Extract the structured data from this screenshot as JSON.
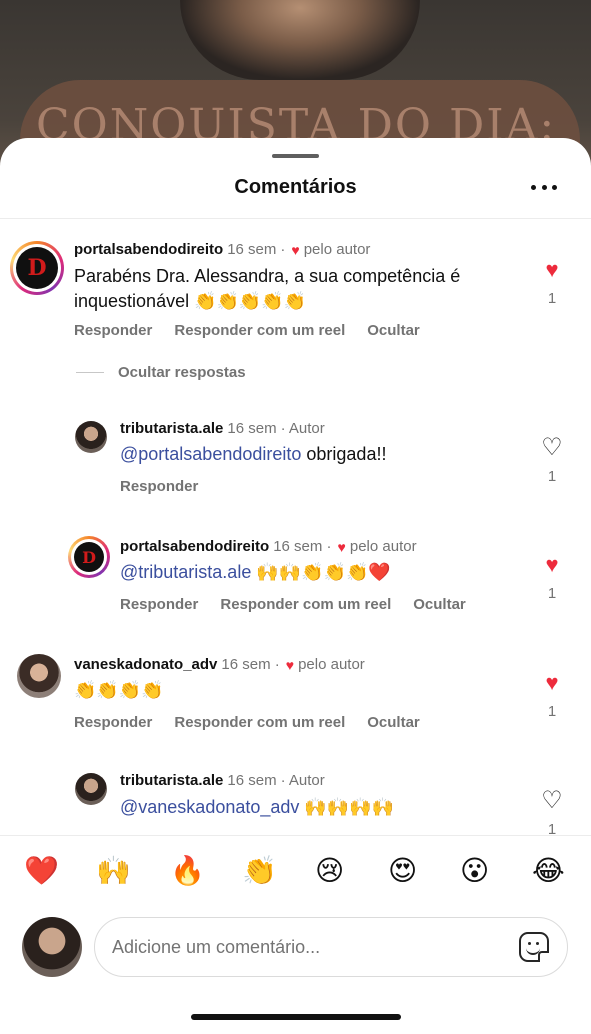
{
  "background": {
    "banner_text": "CONQUISTA DO DIA:"
  },
  "header": {
    "title": "Comentários"
  },
  "comments": [
    {
      "username": "portalsabendodireito",
      "avatar_letter": "D",
      "time": "16 sem",
      "liked_by_author": "pelo autor",
      "text_line1": "Parabéns Dra. Alessandra,  a sua competência é",
      "text_line2": "inquestionável 👏👏👏👏👏",
      "likes": "1",
      "liked": true,
      "actions": [
        "Responder",
        "Responder com um reel",
        "Ocultar"
      ]
    },
    {
      "username": "tributarista.ale",
      "time": "16 sem",
      "author_tag": "· Autor",
      "mention": "@portalsabendodireito",
      "text": " obrigada!!",
      "likes": "1",
      "liked": false,
      "actions": [
        "Responder"
      ]
    },
    {
      "username": "portalsabendodireito",
      "avatar_letter": "D",
      "time": "16 sem ·",
      "liked_by_author": "pelo autor",
      "mention": "@tributarista.ale",
      "text": " 🙌🙌👏👏👏❤️",
      "likes": "1",
      "liked": true,
      "actions": [
        "Responder",
        "Responder com um reel",
        "Ocultar"
      ]
    },
    {
      "username": "vaneskadonato_adv",
      "time": "16 sem ·",
      "liked_by_author": "pelo autor",
      "text": "👏👏👏👏",
      "likes": "1",
      "liked": true,
      "actions": [
        "Responder",
        "Responder com um reel",
        "Ocultar"
      ]
    },
    {
      "username": "tributarista.ale",
      "time": "16 sem",
      "author_tag": "· Autor",
      "mention": "@vaneskadonato_adv",
      "text": " 🙌🙌🙌🙌",
      "likes": "1",
      "liked": false,
      "actions": [
        "Responder"
      ]
    }
  ],
  "hide_replies": "Ocultar respostas",
  "emoji_bar": [
    "❤️",
    "🙌",
    "🔥",
    "👏",
    "😢",
    "😍",
    "😮",
    "😂"
  ],
  "composer": {
    "placeholder": "Adicione um comentário..."
  },
  "colors": {
    "like_red": "#ed2b3c",
    "mention_blue": "#3b4f9e",
    "meta_gray": "#737373"
  },
  "icons": {
    "menu": "more-horizontal-icon",
    "like": "heart-icon",
    "sticker": "sticker-icon"
  }
}
